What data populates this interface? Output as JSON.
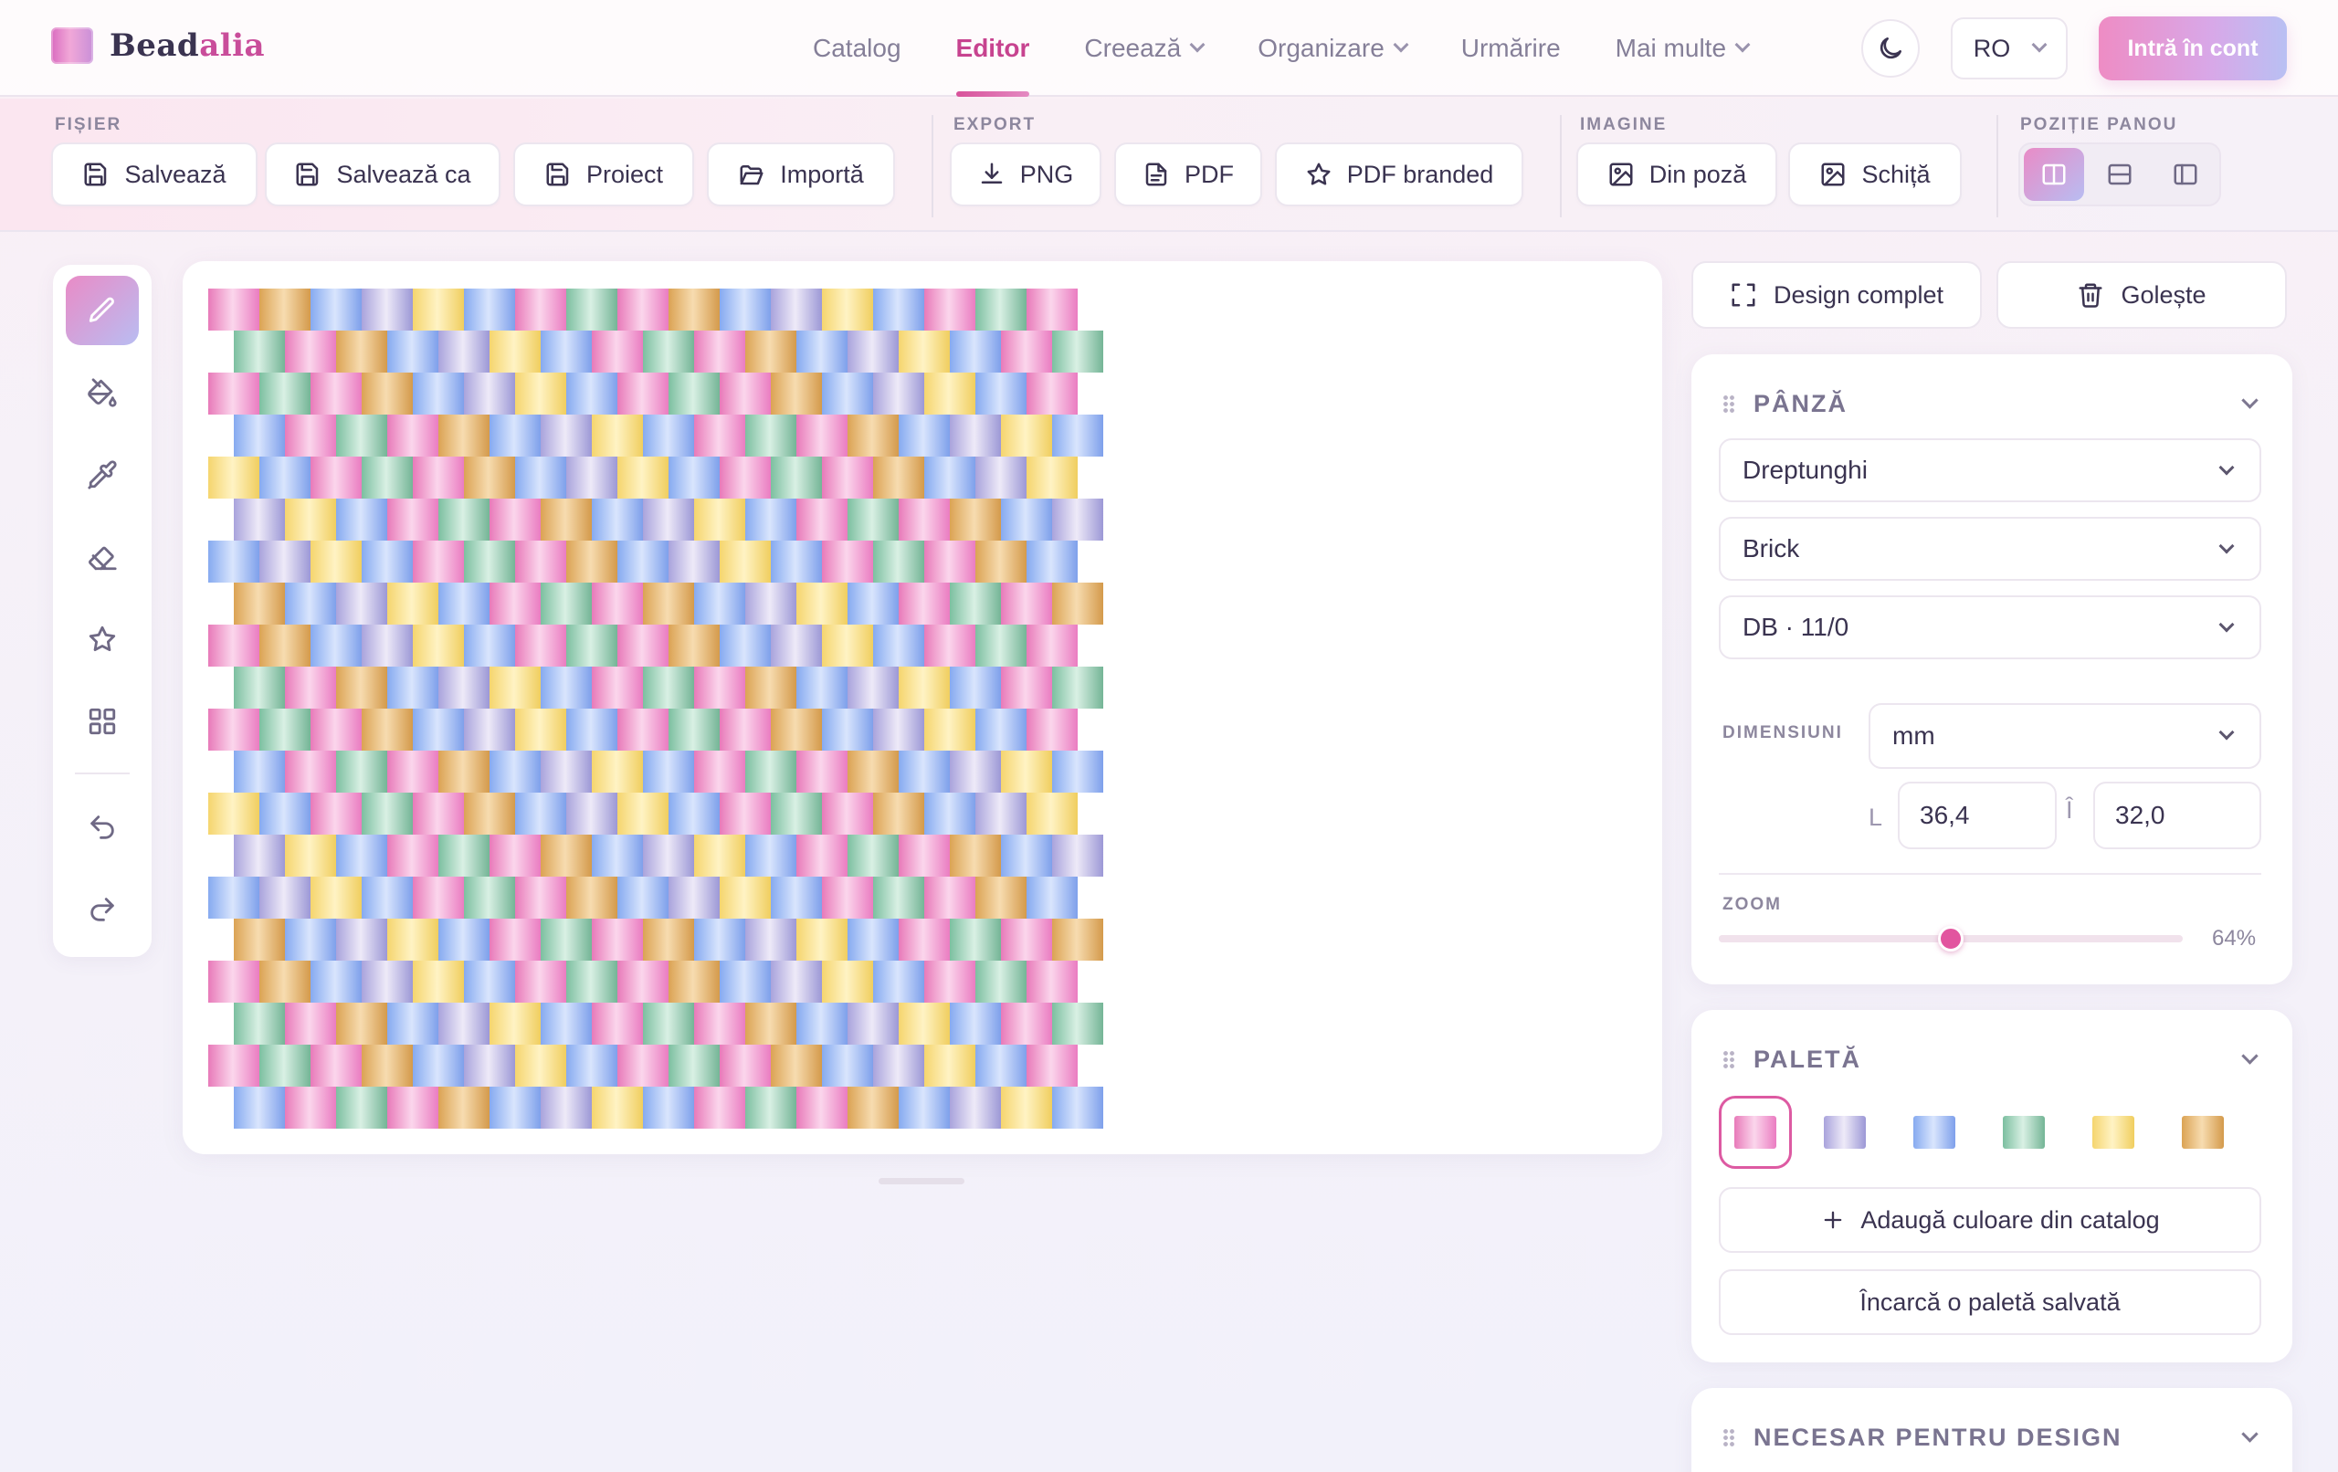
{
  "brand": {
    "name_prefix": "Bead",
    "name_accent": "alia"
  },
  "nav": {
    "links": [
      {
        "label": "Catalog",
        "dropdown": false,
        "active": false
      },
      {
        "label": "Editor",
        "dropdown": false,
        "active": true
      },
      {
        "label": "Creează",
        "dropdown": true,
        "active": false
      },
      {
        "label": "Organizare",
        "dropdown": true,
        "active": false
      },
      {
        "label": "Urmărire",
        "dropdown": false,
        "active": false
      },
      {
        "label": "Mai multe",
        "dropdown": true,
        "active": false
      }
    ],
    "theme_icon": "moon-icon",
    "language": "RO",
    "login_label": "Intră în cont"
  },
  "toolbar": {
    "file": {
      "label": "FIȘIER",
      "save": "Salvează",
      "save_as": "Salvează ca",
      "project": "Proiect",
      "import": "Importă"
    },
    "export": {
      "label": "EXPORT",
      "png": "PNG",
      "pdf": "PDF",
      "pdf_branded": "PDF branded"
    },
    "image": {
      "label": "IMAGINE",
      "from_photo": "Din poză",
      "sketch": "Schiță"
    },
    "panel_position": {
      "label": "POZIȚIE PANOU",
      "options": [
        "panel-right-icon",
        "panel-bottom-icon",
        "panel-left-icon"
      ],
      "selected": 0
    }
  },
  "tools": {
    "items": [
      "pencil-icon",
      "paint-bucket-icon",
      "eyedropper-icon",
      "eraser-icon",
      "star-icon",
      "grid-icon"
    ],
    "history": [
      "undo-icon",
      "redo-icon"
    ],
    "active": 0
  },
  "canvas": {
    "stitch": "brick",
    "rows": 20,
    "beads_per_row": 17,
    "color_cycle": [
      "pink",
      "lavender",
      "pink",
      "amber",
      "yellow",
      "mint",
      "blue",
      "blue"
    ]
  },
  "right_panel": {
    "full_design": "Design complet",
    "clear": "Golește",
    "canvas_section": {
      "title": "PÂNZĂ",
      "shape": "Dreptunghi",
      "stitch": "Brick",
      "bead": "DB · 11/0",
      "dimensions_label": "DIMENSIUNI",
      "unit": "mm",
      "width_letter": "L",
      "width": "36,4",
      "height_letter": "Î",
      "height": "32,0",
      "zoom_label": "ZOOM",
      "zoom_value": "64%",
      "zoom_fraction": 0.5
    },
    "palette_section": {
      "title": "PALETĂ",
      "swatches": [
        "pink",
        "lavender",
        "blue",
        "mint",
        "yellow",
        "amber"
      ],
      "selected": 0,
      "add_label": "Adaugă culoare din catalog",
      "load_label": "Încarcă o paletă salvată"
    },
    "needed_section": {
      "title": "NECESAR PENTRU DESIGN"
    }
  },
  "colors": {
    "accent": "#c7438f",
    "pink": [
      "#e87ab9",
      "#fbd6ec",
      "#ea7cc1"
    ],
    "lavender": [
      "#a9a3dc",
      "#eeeaf8",
      "#9c98d6"
    ],
    "blue": [
      "#86aaf0",
      "#d9e5fd",
      "#7ea0eb"
    ],
    "mint": [
      "#7cbfa0",
      "#d9f0e4",
      "#74b596"
    ],
    "yellow": [
      "#f5d56e",
      "#fff3c4",
      "#f0ce5f"
    ],
    "amber": [
      "#dba354",
      "#f7dcb0",
      "#d49a4b"
    ]
  }
}
